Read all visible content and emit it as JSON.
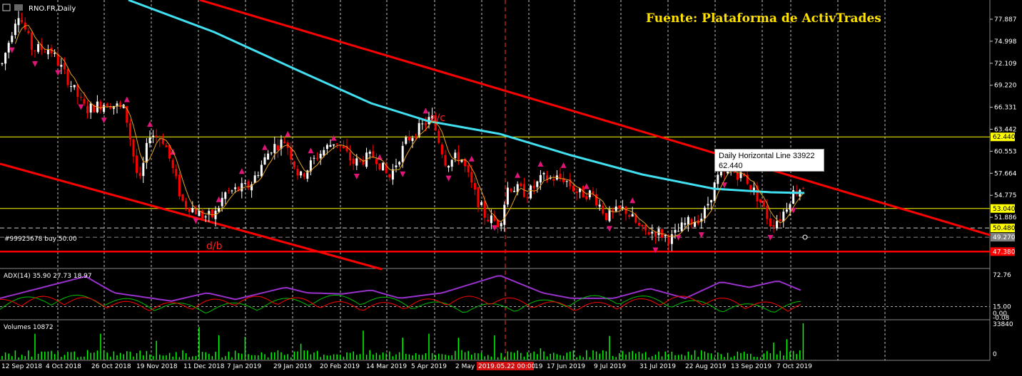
{
  "window": {
    "symbol_title": "RNO.FR,Daily"
  },
  "annotations": {
    "source": "Fuente: Plataforma de ActivTrades",
    "label_ac": "a/c",
    "label_db": "d/b",
    "order_label": "#99925678 buy 50.00"
  },
  "tooltip": {
    "line1": "Daily Horizontal Line 33922",
    "line2": "62.440"
  },
  "price_axis": {
    "ticks": [
      "77.887",
      "74.998",
      "72.109",
      "69.220",
      "66.331",
      "63.442",
      "60.553",
      "57.664",
      "54.775",
      "51.886"
    ],
    "ticks_bottom": [
      "49.270"
    ],
    "badges": [
      {
        "text": "62.440",
        "bg": "#ffff00",
        "fg": "#000000"
      },
      {
        "text": "53.040",
        "bg": "#ffff00",
        "fg": "#000000"
      },
      {
        "text": "50.480",
        "bg": "#ffff00",
        "fg": "#000000"
      },
      {
        "text": "49.270",
        "bg": "#7f7f7f",
        "fg": "#ffffff"
      },
      {
        "text": "47.380",
        "bg": "#ff0000",
        "fg": "#ffffff"
      }
    ]
  },
  "adx_panel": {
    "title": "ADX(14) 35.90 27.73 18.97",
    "ticks": [
      "72.76",
      "15.00",
      "0.00",
      "-0.08"
    ]
  },
  "volume_panel": {
    "title": "Volumes 10872",
    "ticks": [
      "33840",
      "0"
    ]
  },
  "time_axis": {
    "labels": [
      "12 Sep 2018",
      "4 Oct 2018",
      "26 Oct 2018",
      "19 Nov 2018",
      "11 Dec 2018",
      "7 Jan 2019",
      "29 Jan 2019",
      "20 Feb 2019",
      "14 Mar 2019",
      "5 Apr 2019",
      "2 May",
      "17 Jun 2019",
      "9 Jul 2019",
      "31 Jul 2019",
      "22 Aug 2019",
      "13 Sep 2019",
      "7 Oct 2019"
    ],
    "highlight_label": "2019.05.22 00:00",
    "highlight_tail": "19"
  },
  "colors": {
    "background": "#000000",
    "grid": "#c0c0c0",
    "bull_candle": "#ffffff",
    "bear_candle": "#ff0000",
    "channel": "#ff0000",
    "ma200": "#40e0f0",
    "ma20": "#e6a020",
    "fractal": "#e0157a",
    "hline": "#ffff00",
    "volume": "#00ff00",
    "adx_main": "#9932cc",
    "adx_plus": "#00c000",
    "adx_minus": "#ff0000"
  }
}
